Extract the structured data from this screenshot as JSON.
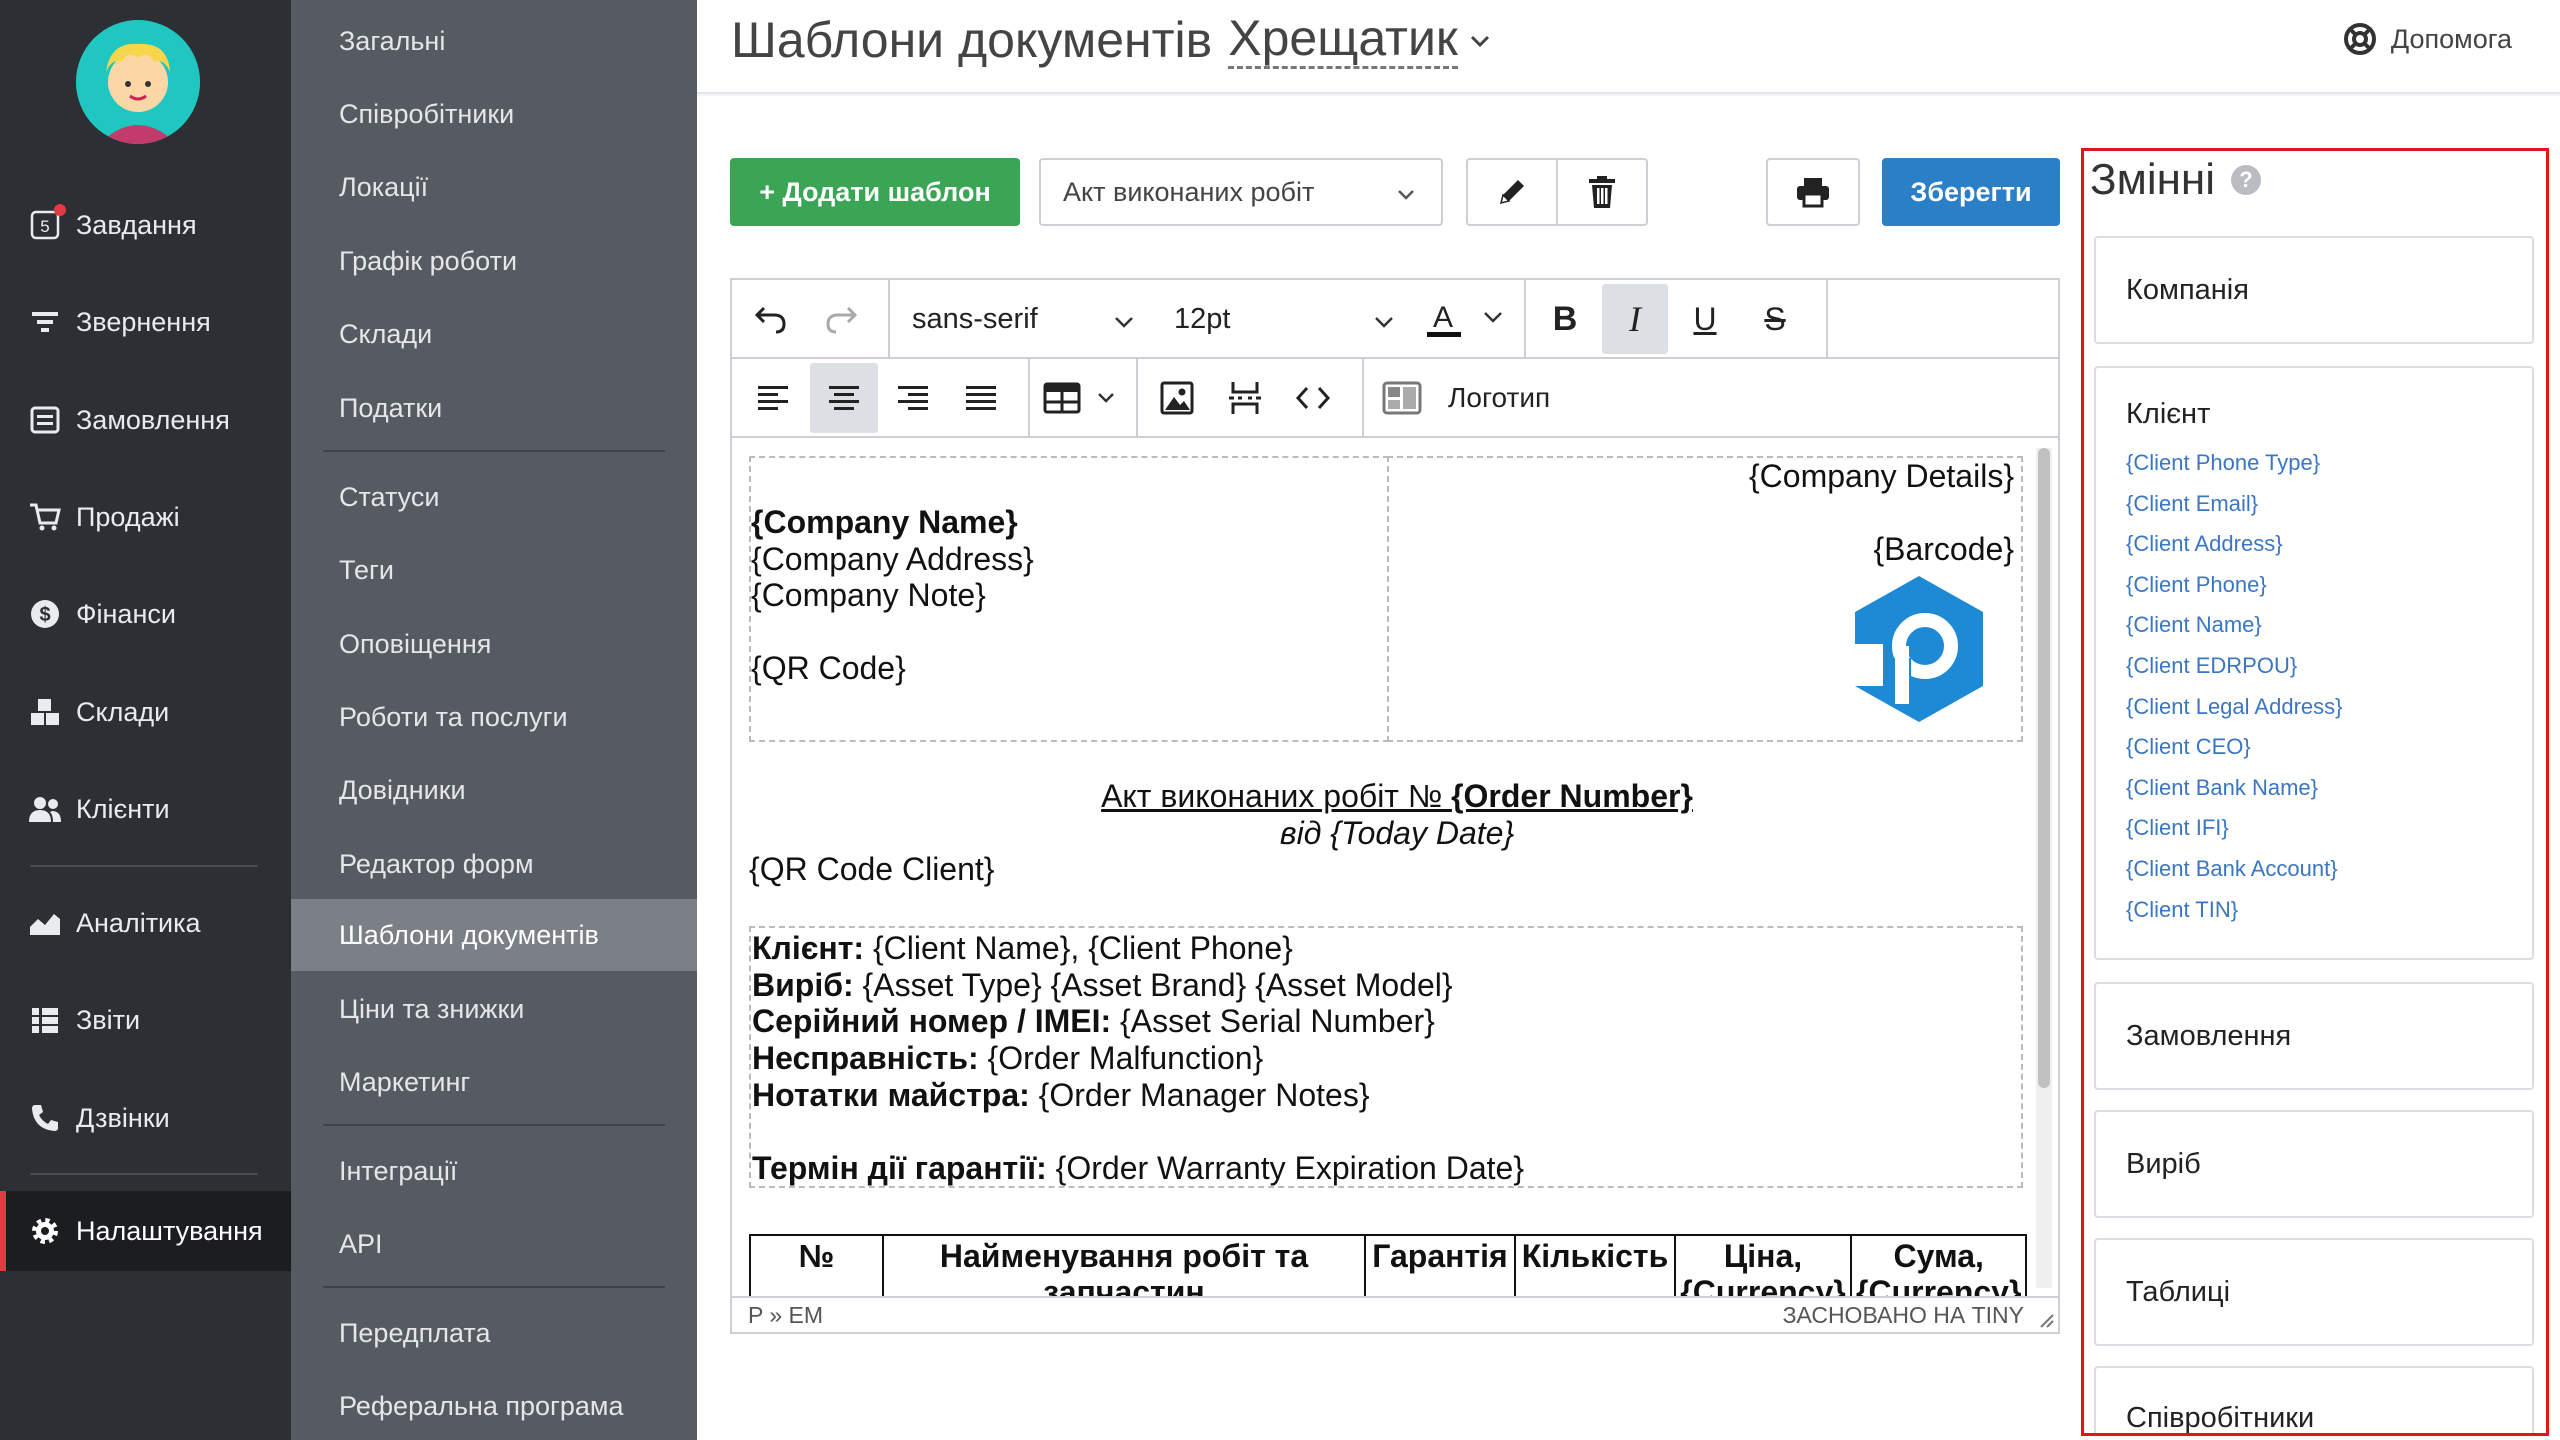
{
  "sidebar": {
    "tasks_count": "5",
    "items": [
      {
        "label": "Завдання",
        "icon": "tasks-icon"
      },
      {
        "label": "Звернення",
        "icon": "filter-icon"
      },
      {
        "label": "Замовлення",
        "icon": "orders-icon"
      },
      {
        "label": "Продажі",
        "icon": "cart-icon"
      },
      {
        "label": "Фінанси",
        "icon": "dollar-icon"
      },
      {
        "label": "Склади",
        "icon": "boxes-icon"
      },
      {
        "label": "Клієнти",
        "icon": "users-icon"
      },
      {
        "label": "Аналітика",
        "icon": "chart-icon"
      },
      {
        "label": "Звіти",
        "icon": "reports-icon"
      },
      {
        "label": "Дзвінки",
        "icon": "phone-icon"
      },
      {
        "label": "Налаштування",
        "icon": "gear-icon"
      }
    ],
    "active": "Налаштування"
  },
  "submenu": {
    "items": [
      "Загальні",
      "Співробітники",
      "Локації",
      "Графік роботи",
      "Склади",
      "Податки",
      "Статуси",
      "Теги",
      "Оповіщення",
      "Роботи та послуги",
      "Довідники",
      "Редактор форм",
      "Шаблони документів",
      "Ціни та знижки",
      "Маркетинг",
      "Інтеграції",
      "API",
      "Передплата",
      "Реферальна програма"
    ],
    "active": "Шаблони документів"
  },
  "header": {
    "title": "Шаблони документів",
    "location": "Хрещатик",
    "help_label": "Допомога"
  },
  "toolbar": {
    "add_template_label": "+ Додати шаблон",
    "template_selected": "Акт виконаних робіт",
    "save_label": "Зберегти"
  },
  "editor": {
    "font_family": "sans-serif",
    "font_size": "12pt",
    "logo_label": "Логотип",
    "status_path": "P » EM",
    "status_powered": "ЗАСНОВАНО НА TINY"
  },
  "document": {
    "company_details": "{Company Details}",
    "barcode": "{Barcode}",
    "company_name": "{Company Name}",
    "company_address": "{Company Address}",
    "company_note": "{Company Note}",
    "qr_code": "{QR Code}",
    "act_title": "Акт виконаних робіт № ",
    "order_number": "{Order Number}",
    "date_line": "від {Today Date}",
    "qr_code_client": "{QR Code Client}",
    "rows": [
      {
        "label": "Клієнт:",
        "value": " {Client Name}, {Client Phone}"
      },
      {
        "label": "Виріб:",
        "value": " {Asset Type} {Asset Brand} {Asset Model}"
      },
      {
        "label": "Серійний номер / IMEI:",
        "value": " {Asset Serial Number}"
      },
      {
        "label": "Несправність:",
        "value": " {Order Malfunction}"
      },
      {
        "label": "Нотатки майстра:",
        "value": " {Order Manager Notes}"
      }
    ],
    "warranty_label": "Термін дії гарантії:",
    "warranty_value": " {Order Warranty Expiration Date}",
    "table_headers": [
      "№",
      "Найменування робіт та запчастин",
      "Гарантія",
      "Кількість",
      "Ціна, {Currency}",
      "Сума, {Currency}"
    ]
  },
  "variables": {
    "title": "Змінні",
    "help": "?",
    "groups": [
      "Компанія",
      "Клієнт",
      "Замовлення",
      "Виріб",
      "Таблиці",
      "Співробітники"
    ],
    "client_vars": [
      "{Client Phone Type}",
      "{Client Email}",
      "{Client Address}",
      "{Client Phone}",
      "{Client Name}",
      "{Client EDRPOU}",
      "{Client Legal Address}",
      "{Client CEO}",
      "{Client Bank Name}",
      "{Client IFI}",
      "{Client Bank Account}",
      "{Client TIN}"
    ]
  },
  "colors": {
    "sidebar_bg": "#2c2f33",
    "submenu_bg": "#565b62",
    "active_marker": "#e63946",
    "add_button": "#3aa655",
    "save_button": "#2b7fc7",
    "link": "#3a76c4",
    "variables_border": "#e0161f"
  }
}
